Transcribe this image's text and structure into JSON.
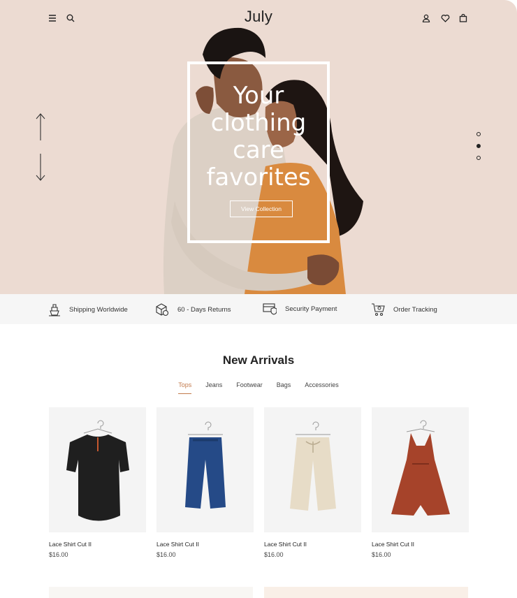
{
  "brand": {
    "logo": "July"
  },
  "nav": {
    "menu_icon": "menu-icon",
    "search_icon": "search-icon",
    "account_icon": "user-icon",
    "wishlist_icon": "heart-icon",
    "cart_icon": "bag-icon"
  },
  "hero": {
    "headline": [
      "Your",
      "clothing",
      "care",
      "favorites"
    ],
    "button_label": "View Collection",
    "slides": 3,
    "active_slide": 2,
    "background": "#ecdbd2"
  },
  "features": [
    {
      "label": "Shipping Worldwide",
      "icon": "ship-icon"
    },
    {
      "label": "60 - Days Returns",
      "icon": "return-box-icon"
    },
    {
      "label": "Security Payment",
      "icon": "secure-payment-icon"
    },
    {
      "label": "Order Tracking",
      "icon": "tracking-cart-icon"
    }
  ],
  "new_arrivals": {
    "title": "New Arrivals",
    "tabs": [
      "Tops",
      "Jeans",
      "Footwear",
      "Bags",
      "Accessories"
    ],
    "active_tab": "Tops",
    "accent": "#c27a4c",
    "products": [
      {
        "name": "Lace Shirt Cut II",
        "price": "$16.00",
        "image": "black-tunic"
      },
      {
        "name": "Lace Shirt Cut II",
        "price": "$16.00",
        "image": "blue-pants"
      },
      {
        "name": "Lace Shirt Cut II",
        "price": "$16.00",
        "image": "beige-pants"
      },
      {
        "name": "Lace Shirt Cut II",
        "price": "$16.00",
        "image": "rust-dress"
      }
    ]
  }
}
